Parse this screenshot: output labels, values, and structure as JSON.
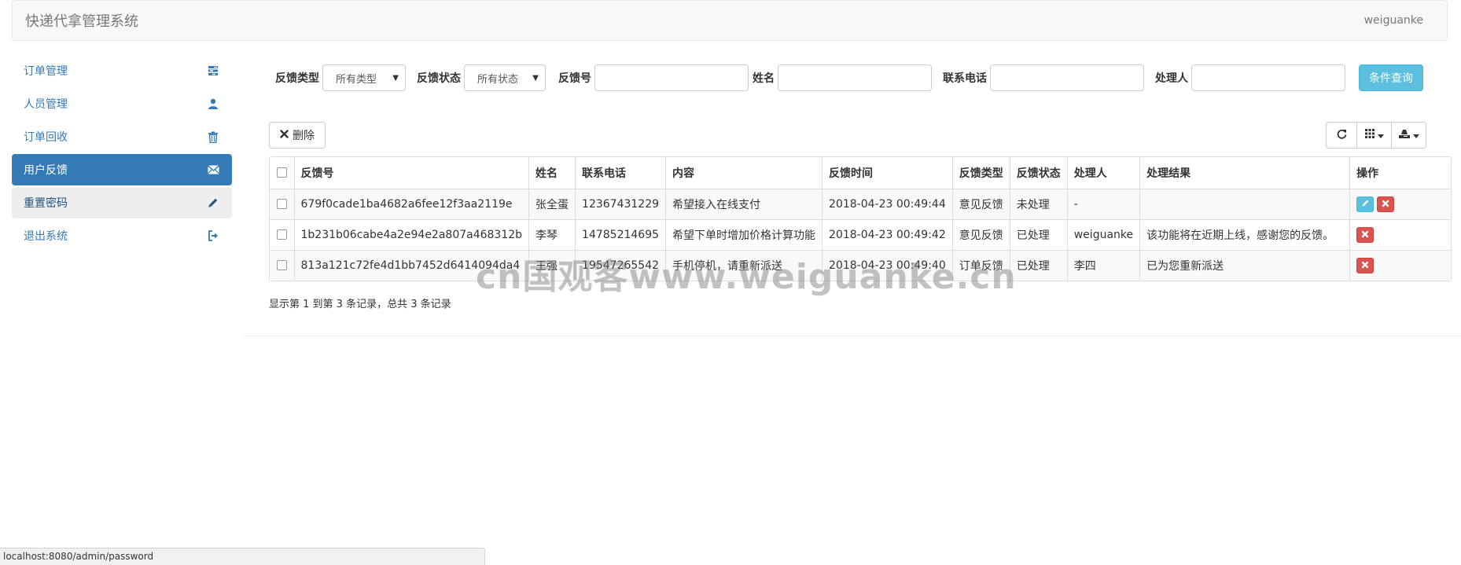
{
  "header": {
    "title": "快递代拿管理系统",
    "user": "weiguanke"
  },
  "sidebar": {
    "items": [
      {
        "label": "订单管理",
        "icon": "tasks-icon"
      },
      {
        "label": "人员管理",
        "icon": "user-icon"
      },
      {
        "label": "订单回收",
        "icon": "trash-icon"
      },
      {
        "label": "用户反馈",
        "icon": "envelope-icon",
        "active": true
      },
      {
        "label": "重置密码",
        "icon": "pencil-icon",
        "hover": true
      },
      {
        "label": "退出系统",
        "icon": "logout-icon"
      }
    ]
  },
  "filters": {
    "feedback_type_label": "反馈类型",
    "feedback_type_value": "所有类型",
    "feedback_status_label": "反馈状态",
    "feedback_status_value": "所有状态",
    "feedback_no_label": "反馈号",
    "name_label": "姓名",
    "phone_label": "联系电话",
    "handler_label": "处理人",
    "query_button": "条件查询"
  },
  "toolbar": {
    "delete_label": "删除"
  },
  "table": {
    "columns": [
      "反馈号",
      "姓名",
      "联系电话",
      "内容",
      "反馈时间",
      "反馈类型",
      "反馈状态",
      "处理人",
      "处理结果",
      "操作"
    ],
    "rows": [
      {
        "id": "679f0cade1ba4682a6fee12f3aa2119e",
        "name": "张全蛋",
        "phone": "12367431229",
        "content": "希望接入在线支付",
        "time": "2018-04-23 00:49:44",
        "type": "意见反馈",
        "status": "未处理",
        "handler": "-",
        "result": "",
        "editable": true
      },
      {
        "id": "1b231b06cabe4a2e94e2a807a468312b",
        "name": "李琴",
        "phone": "14785214695",
        "content": "希望下单时增加价格计算功能",
        "time": "2018-04-23 00:49:42",
        "type": "意见反馈",
        "status": "已处理",
        "handler": "weiguanke",
        "result": "该功能将在近期上线，感谢您的反馈。",
        "editable": false
      },
      {
        "id": "813a121c72fe4d1bb7452d6414094da4",
        "name": "王强",
        "phone": "19547265542",
        "content": "手机停机，请重新派送",
        "time": "2018-04-23 00:49:40",
        "type": "订单反馈",
        "status": "已处理",
        "handler": "李四",
        "result": "已为您重新派送",
        "editable": false
      }
    ]
  },
  "pager": {
    "summary": "显示第 1 到第 3 条记录，总共 3 条记录"
  },
  "statusbar": {
    "url": "localhost:8080/admin/password"
  },
  "watermark": {
    "text": "cn国观客www.weiguanke.cn"
  },
  "colors": {
    "primary": "#337ab7",
    "info": "#5bc0de",
    "danger": "#d9534f"
  }
}
